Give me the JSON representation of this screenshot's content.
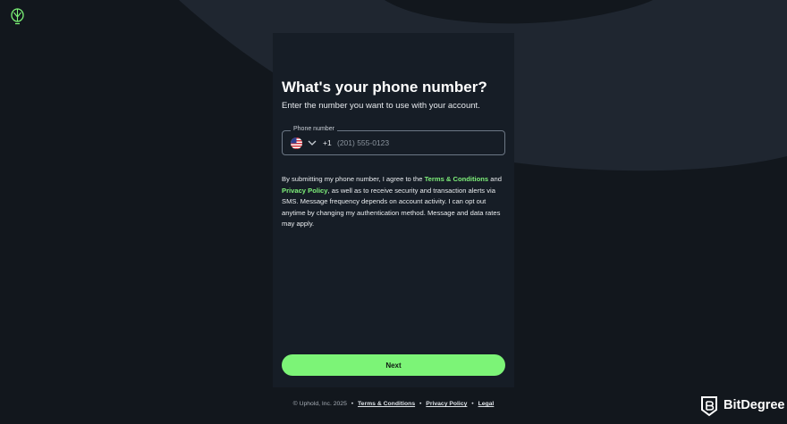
{
  "brand": {
    "logo_icon": "uphold-logo-icon",
    "accent_color": "#7cf477"
  },
  "form": {
    "title": "What's your phone number?",
    "subtitle": "Enter the number you want to use with your account.",
    "phone_label": "Phone number",
    "country_flag_icon": "us-flag-icon",
    "dial_code": "+1",
    "phone_placeholder": "(201) 555-0123",
    "phone_value": "",
    "disclaimer": {
      "part1": "By submitting my phone number, I agree to the ",
      "terms_link": "Terms & Conditions",
      "part2": " and ",
      "privacy_link": "Privacy Policy",
      "part3": ", as well as to receive security and transaction alerts via SMS. Message frequency depends on account activity. I can opt out anytime by changing my authentication method. Message and data rates may apply."
    },
    "next_label": "Next"
  },
  "footer": {
    "copyright": "© Uphold, Inc. 2025",
    "separator": "•",
    "terms": "Terms & Conditions",
    "privacy": "Privacy Policy",
    "legal": "Legal"
  },
  "watermark": {
    "icon": "bitdegree-shield-icon",
    "text": "BitDegree"
  }
}
